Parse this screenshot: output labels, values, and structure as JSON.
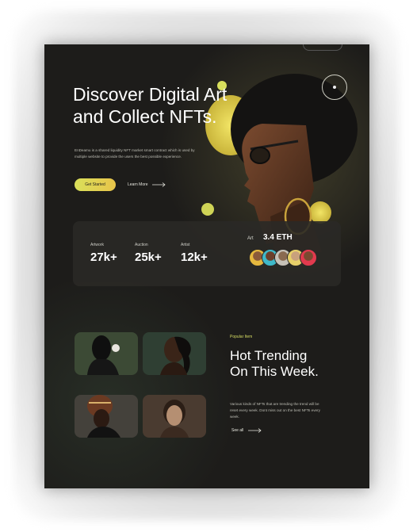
{
  "hero": {
    "title": "Discover Digital Art and Collect NFTs.",
    "description": "EnDeamu is a shared liquidity NFT market smart contract which is used by multiple website to provide the users the best possible experience.",
    "get_started_label": "Get Started",
    "learn_more_label": "Learn More"
  },
  "stats": {
    "items": [
      {
        "label": "Artwork",
        "value": "27k+"
      },
      {
        "label": "Auction",
        "value": "25k+"
      },
      {
        "label": "Artist",
        "value": "12k+"
      }
    ],
    "art_label": "Art",
    "art_value": "3.4 ETH"
  },
  "trending": {
    "tag": "Popular Item",
    "title": "Hot Trending On This Week.",
    "description": "Various kinds of NFTs that are trending the trend will be reset every week. Dont miss out on the best NFTs every week.",
    "see_all_label": "See all"
  },
  "colors": {
    "background": "#1d1c1a",
    "accent_yellow": "#d9e05a",
    "accent_green": "#8fd05a",
    "text_primary": "#ffffff"
  }
}
